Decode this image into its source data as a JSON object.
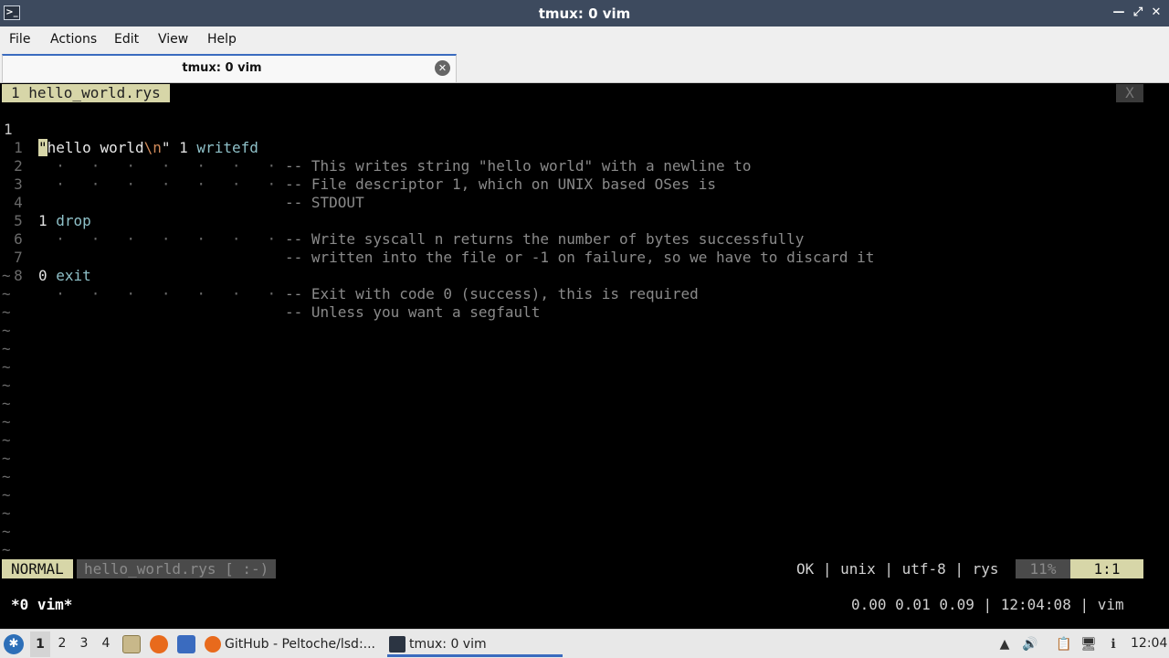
{
  "window": {
    "title": "tmux: 0 vim",
    "minimize": "—",
    "maximize": "⤢",
    "close": "✕"
  },
  "menubar": [
    "File",
    "Actions",
    "Edit",
    "View",
    "Help"
  ],
  "tab": {
    "label": "tmux: 0 vim",
    "close": "✕"
  },
  "vim": {
    "buffer_tab": "1 hello_world.rys",
    "close_tab": "X",
    "lines": [
      {
        "num": "1",
        "cursor_char": "\"",
        "str": "hello world",
        "esc": "\\n",
        "str_end": "\"",
        "arg": " 1 ",
        "kw": "writefd",
        "comment": "-- This writes string \"hello world\" with a newline to"
      },
      {
        "num": "1",
        "dots": "  ·   ·   ·   ·   ·   ·   ·",
        "comment": "-- File descriptor 1, which on UNIX based OSes is"
      },
      {
        "num": "2",
        "dots": "  ·   ·   ·   ·   ·   ·   ·",
        "comment": "-- STDOUT"
      },
      {
        "num": "3"
      },
      {
        "num": "4",
        "num_val": "1",
        "kw": " drop",
        "comment": "-- Write syscall n returns the number of bytes successfully"
      },
      {
        "num": "5",
        "dots": "  ·   ·   ·   ·   ·   ·   ·",
        "comment": "-- written into the file or -1 on failure, so we have to discard it"
      },
      {
        "num": "6"
      },
      {
        "num": "7",
        "num_val": "0",
        "kw": " exit",
        "comment": "-- Exit with code 0 (success), this is required"
      },
      {
        "num": "8",
        "dots": "  ·   ·   ·   ·   ·   ·   ·",
        "comment": "-- Unless you want a segfault"
      }
    ],
    "tilde": "~",
    "status": {
      "mode": "NORMAL",
      "file": "hello_world.rys [ :-)",
      "right": "OK | unix | utf-8 | rys",
      "percent": "11%",
      "position": "1:1"
    }
  },
  "tmux": {
    "window": "*0 vim*",
    "right": "0.00 0.01 0.09 | 12:04:08 | vim"
  },
  "taskbar": {
    "workspaces": [
      "1",
      "2",
      "3",
      "4"
    ],
    "tasks": [
      {
        "label": "GitHub - Peltoche/lsd:..."
      },
      {
        "label": "tmux: 0 vim"
      }
    ],
    "clock": "12:04"
  }
}
